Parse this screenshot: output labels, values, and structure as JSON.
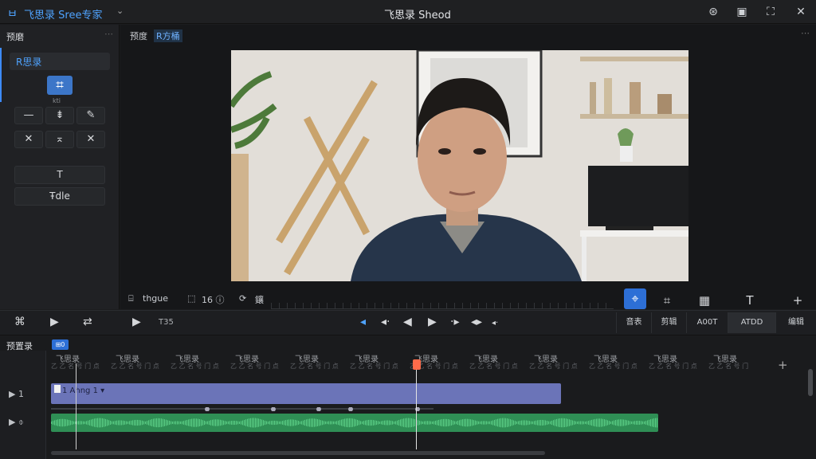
{
  "titlebar": {
    "app_title": "飞思录 Sree专家",
    "window_title": "飞思录 Sheod",
    "logo_glyph": "ㅂ",
    "caret_glyph": "⌄",
    "buttons": [
      {
        "name": "record-icon",
        "glyph": "⊛"
      },
      {
        "name": "layout-icon",
        "glyph": "▣"
      },
      {
        "name": "fullscreen-icon",
        "glyph": "⛶"
      },
      {
        "name": "close-icon",
        "glyph": "✕"
      }
    ]
  },
  "left_panel": {
    "header": "预磨",
    "more_glyph": "⋯",
    "tab": "R思录",
    "crop_glyph": "⌗",
    "crop_caption": "kti",
    "tools_row1": [
      "—",
      "⇟",
      "✎"
    ],
    "tools_row2": [
      "✕",
      "⌅",
      "✕"
    ],
    "text_button": "T",
    "title_button": "Ŧdle"
  },
  "preview": {
    "label": "预度",
    "tag": "R方桶",
    "more_glyph": "⋯"
  },
  "controlbar": {
    "shape_label": "thgue",
    "ratio_label": "16 ⓘ",
    "sync_label": "鑲",
    "shape_glyph": "⌸",
    "ratio_glyph": "⬚",
    "sync_glyph": "⟳",
    "right_icons": [
      "⌖",
      "⌗",
      "T",
      "+"
    ]
  },
  "playbar": {
    "left_icons": [
      "⌘",
      "▶",
      "⇄"
    ],
    "play_glyph": "▶",
    "time": "T35",
    "transport": [
      "◂",
      "◂·",
      "◀",
      "▶",
      "·▸",
      "◂▸",
      "◂·"
    ],
    "segments": [
      "音表",
      "剪辑",
      "A00T",
      "ATDD",
      "编辑"
    ]
  },
  "timeline": {
    "title": "预置录",
    "badge": "⊞0",
    "time_label": "飞思录",
    "time_sub": "乙 乙 名 号 门 点",
    "add_glyph": "+",
    "tracks": [
      {
        "head": "▶ 1",
        "label": "1 Ahng 1 ▾",
        "color": "#6b74b8"
      },
      {
        "head": "▶ ⌽",
        "label": "",
        "color": "#2f8f55"
      }
    ],
    "playhead_fraction": 0.52
  },
  "colors": {
    "accent": "#3d8bff",
    "video_track": "#6b74b8",
    "audio_track": "#2f8f55",
    "playhead": "#ff6b4a"
  }
}
